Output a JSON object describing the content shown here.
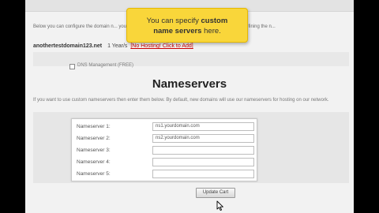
{
  "intro": {
    "text": "Below you can configure the domain n... you would like, providing required information for them and defining the n..."
  },
  "domain": {
    "name": "anothertestdomain123.net",
    "term": "1 Year/s",
    "hosting_link": "[No Hosting! Click to Add]"
  },
  "addon": {
    "label": "DNS Management (FREE)"
  },
  "nameservers": {
    "heading": "Nameservers",
    "description": "If you want to use custom nameservers then enter them below. By default, new domains will use our nameservers for hosting on our network.",
    "rows": [
      {
        "label": "Nameserver 1:",
        "value": "ns1.yourdomain.com"
      },
      {
        "label": "Nameserver 2:",
        "value": "ns2.yourdomain.com"
      },
      {
        "label": "Nameserver 3:",
        "value": ""
      },
      {
        "label": "Nameserver 4:",
        "value": ""
      },
      {
        "label": "Nameserver 5:",
        "value": ""
      }
    ]
  },
  "update_button": "Update Cart",
  "tooltip": {
    "line1_pre": "You can specify ",
    "line1_bold": "custom",
    "line2_bold": "name servers",
    "line2_post": " here."
  },
  "colors": {
    "tooltip_bg": "#f9d63a",
    "link_red": "#cc0000"
  }
}
